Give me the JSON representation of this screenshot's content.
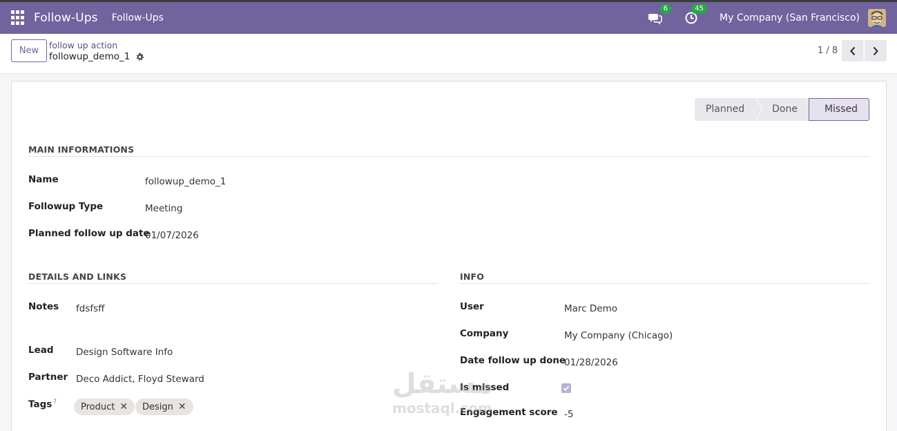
{
  "navbar": {
    "app_title": "Follow-Ups",
    "menu_item": "Follow-Ups",
    "messages_badge": "6",
    "activities_badge": "45",
    "company": "My Company (San Francisco)"
  },
  "control": {
    "new_label": "New",
    "breadcrumb_parent": "follow up action",
    "breadcrumb_current": "followup_demo_1",
    "pager": "1 / 8"
  },
  "statusbar": {
    "stages": [
      "Planned",
      "Done",
      "Missed"
    ],
    "active": "Missed"
  },
  "main_info": {
    "title": "MAIN INFORMATIONS",
    "name_label": "Name",
    "name_value": "followup_demo_1",
    "type_label": "Followup Type",
    "type_value": "Meeting",
    "planned_label": "Planned follow up date",
    "planned_value": "01/07/2026"
  },
  "details": {
    "title": "DETAILS AND LINKS",
    "notes_label": "Notes",
    "notes_value": "fdsfsff",
    "lead_label": "Lead",
    "lead_value": "Design Software Info",
    "partner_label": "Partner",
    "partner_value": "Deco Addict, Floyd Steward",
    "tags_label": "Tags",
    "tags_help": "?",
    "tags": [
      "Product",
      "Design"
    ]
  },
  "info": {
    "title": "INFO",
    "user_label": "User",
    "user_value": "Marc Demo",
    "company_label": "Company",
    "company_value": "My Company (Chicago)",
    "done_label": "Date follow up done",
    "done_value": "01/28/2026",
    "missed_label": "Is missed",
    "missed_checked": true,
    "score_label": "Engagement score",
    "score_value": "-5"
  },
  "watermark": {
    "arabic": "مستقل",
    "latin": "mostaql.com"
  },
  "colors": {
    "brand": "#71639e",
    "badge": "#28a745"
  }
}
